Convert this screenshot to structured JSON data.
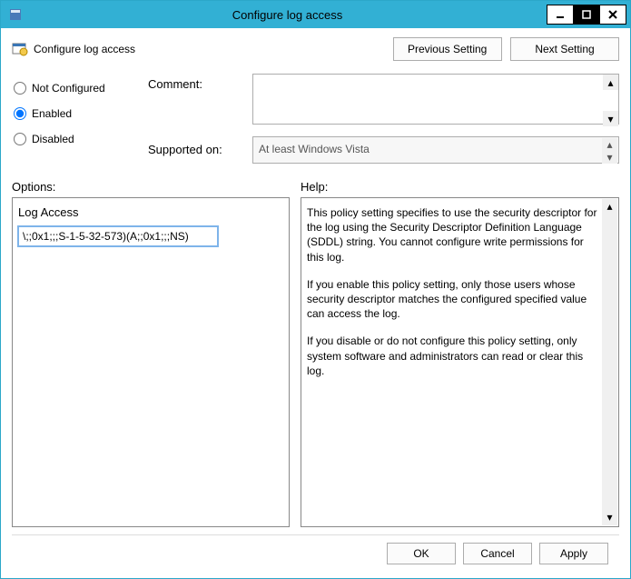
{
  "window": {
    "title": "Configure log access"
  },
  "header": {
    "caption": "Configure log access",
    "prev": "Previous Setting",
    "next": "Next Setting"
  },
  "state": {
    "not_configured": "Not Configured",
    "enabled": "Enabled",
    "disabled": "Disabled",
    "selected": "enabled"
  },
  "fields": {
    "comment_label": "Comment:",
    "comment_value": "",
    "supported_label": "Supported on:",
    "supported_value": "At least Windows Vista"
  },
  "sections": {
    "options": "Options:",
    "help": "Help:"
  },
  "options": {
    "log_access_label": "Log Access",
    "log_access_value": "\\;;0x1;;;S-1-5-32-573)(A;;0x1;;;NS)"
  },
  "help": {
    "p1": "This policy setting specifies to use the security descriptor for the log using the Security Descriptor Definition Language (SDDL) string. You cannot configure write permissions for this log.",
    "p2": "If you enable this policy setting, only those users whose security descriptor matches the configured specified value can access the log.",
    "p3": "If you disable or do not configure this policy setting, only system software and administrators can read or clear this log."
  },
  "footer": {
    "ok": "OK",
    "cancel": "Cancel",
    "apply": "Apply"
  }
}
